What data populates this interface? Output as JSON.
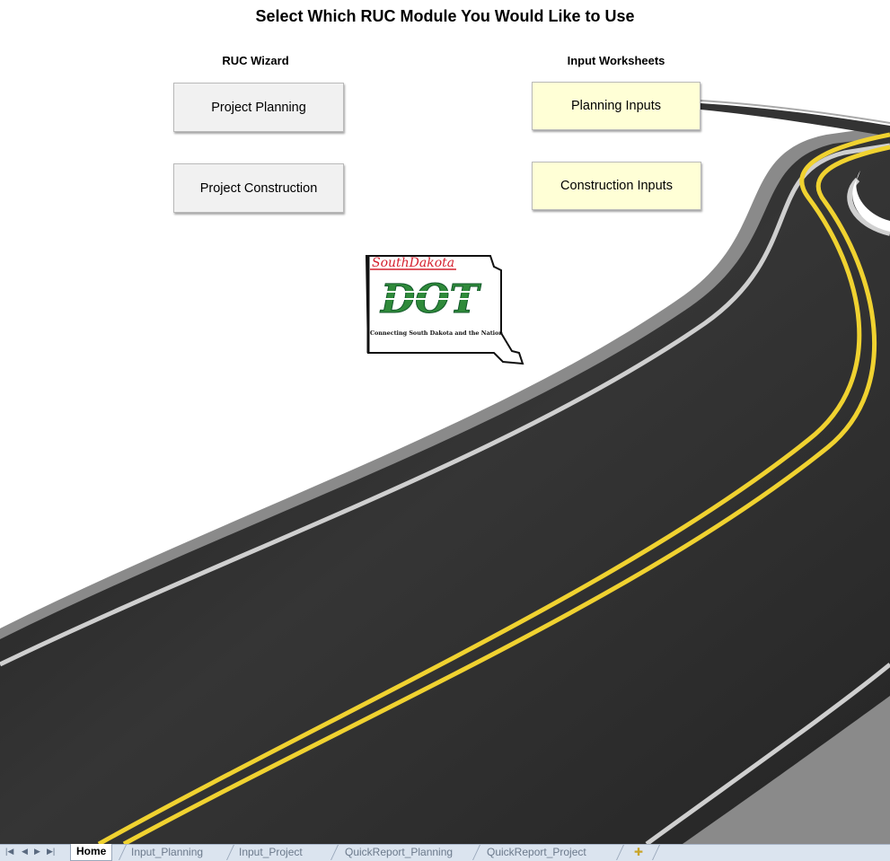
{
  "title": "Select Which RUC Module You Would Like to Use",
  "left_column": {
    "heading": "RUC Wizard",
    "buttons": [
      "Project Planning",
      "Project Construction"
    ]
  },
  "right_column": {
    "heading": "Input Worksheets",
    "buttons": [
      "Planning Inputs",
      "Construction Inputs"
    ]
  },
  "logo": {
    "script_text": "SouthDakota",
    "main_text": "DOT",
    "tagline": "Connecting South Dakota and the Nation"
  },
  "sheet_tabs": {
    "items": [
      "Home",
      "Input_Planning",
      "Input_Project",
      "QuickReport_Planning",
      "QuickReport_Project"
    ],
    "active": "Home",
    "nav_icons": [
      "first-sheet-icon",
      "prev-sheet-icon",
      "next-sheet-icon",
      "last-sheet-icon"
    ],
    "new_sheet_icon": "insert-sheet-icon"
  },
  "colors": {
    "button_gray": "#f1f1f1",
    "button_yellow": "#ffffd6",
    "road_asphalt": "#2b2b2b",
    "center_line": "#f0d230",
    "logo_green": "#2f8a3a",
    "logo_red": "#d5212f"
  }
}
